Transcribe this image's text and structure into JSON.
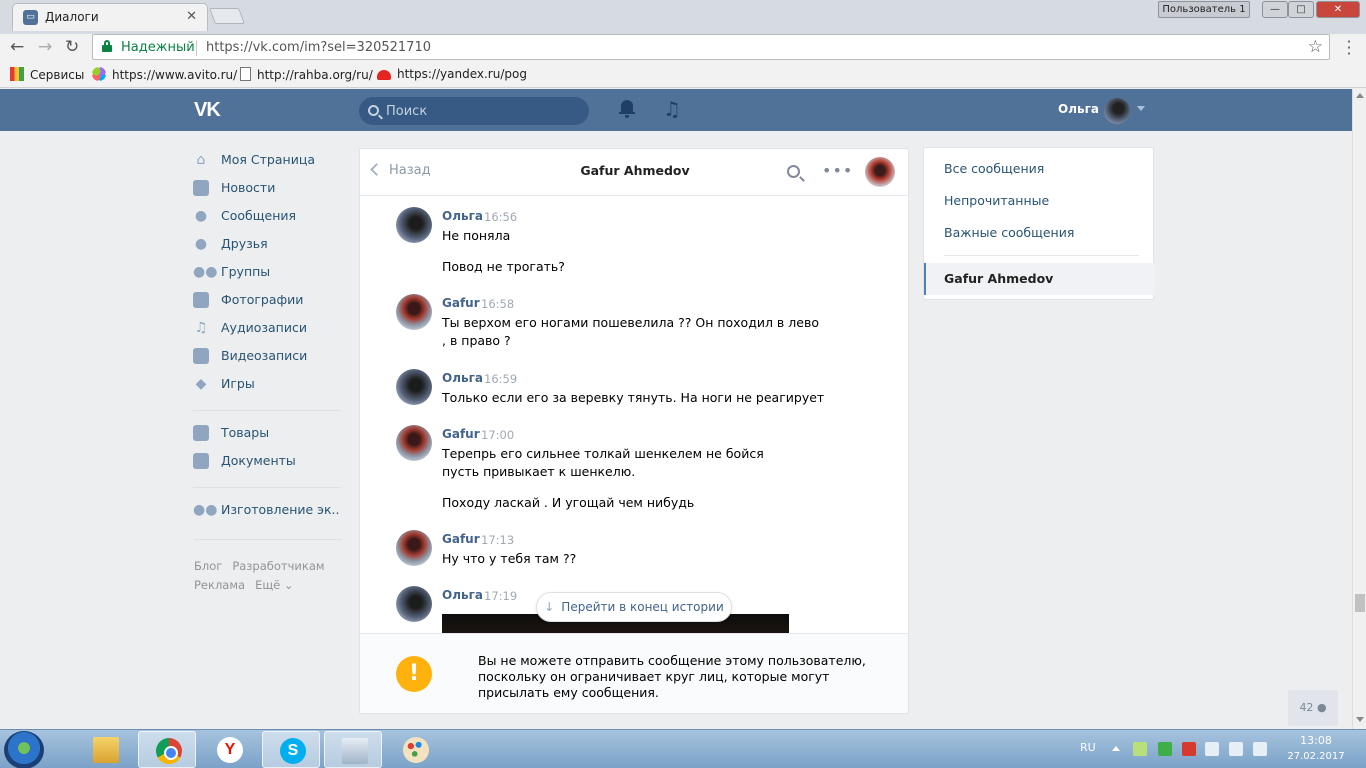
{
  "browser": {
    "tab_title": "Диалоги",
    "tab_close": "✕",
    "user_button": "Пользователь 1",
    "window_min": "—",
    "window_max": "□",
    "window_close": "✕",
    "secure_label": "Надежный",
    "url": "https://vk.com/im?sel=320521710",
    "bookmarks": [
      {
        "label": "Сервисы"
      },
      {
        "label": "https://www.avito.ru/"
      },
      {
        "label": "http://rahba.org/ru/"
      },
      {
        "label": "https://yandex.ru/pog"
      }
    ]
  },
  "header": {
    "logo": "VK",
    "search_placeholder": "Поиск",
    "user_name": "Ольга"
  },
  "left_menu": {
    "items": [
      {
        "label": "Моя Страница",
        "icon": "home-icon"
      },
      {
        "label": "Новости",
        "icon": "news-icon"
      },
      {
        "label": "Сообщения",
        "icon": "messages-icon"
      },
      {
        "label": "Друзья",
        "icon": "friends-icon"
      },
      {
        "label": "Группы",
        "icon": "groups-icon"
      },
      {
        "label": "Фотографии",
        "icon": "camera-icon"
      },
      {
        "label": "Аудиозаписи",
        "icon": "music-icon"
      },
      {
        "label": "Видеозаписи",
        "icon": "video-icon"
      },
      {
        "label": "Игры",
        "icon": "gamepad-icon"
      },
      {
        "label": "Товары",
        "icon": "bag-icon"
      },
      {
        "label": "Документы",
        "icon": "document-icon"
      },
      {
        "label": "Изготовление эк..",
        "icon": "group-icon"
      }
    ],
    "footer": [
      "Блог",
      "Разработчикам",
      "Реклама",
      "Ещё ⌄"
    ]
  },
  "dialog": {
    "back_label": "Назад",
    "title": "Gafur Ahmedov",
    "messages": [
      {
        "author": "Ольга",
        "time": "16:56",
        "lines": [
          "Не поняла",
          "Повод не трогать?"
        ]
      },
      {
        "author": "Gafur",
        "time": "16:58",
        "lines": [
          "Ты верхом его ногами пошевелила ?? Он походил в лево , в право ?"
        ]
      },
      {
        "author": "Ольга",
        "time": "16:59",
        "lines": [
          "Только если его за веревку тянуть. На ноги не реагирует"
        ]
      },
      {
        "author": "Gafur",
        "time": "17:00",
        "lines": [
          "Терепрь его сильнее толкай шенкелем не бойся пусть привыкает к шенкелю.",
          "Походу ласкай . И угощай чем нибудь"
        ]
      },
      {
        "author": "Gafur",
        "time": "17:13",
        "lines": [
          "Ну что у тебя там ??"
        ]
      },
      {
        "author": "Ольга",
        "time": "17:19",
        "lines": []
      }
    ],
    "jump_label": "Перейти в конец истории",
    "warning_icon": "!",
    "warning_text": "Вы не можете отправить сообщение этому пользователю, поскольку он ограничивает круг лиц, которые могут присылать ему сообщения."
  },
  "right_menu": {
    "items": [
      "Все сообщения",
      "Непрочитанные",
      "Важные сообщения"
    ],
    "active": "Gafur Ahmedov"
  },
  "online_count": "42",
  "taskbar": {
    "lang": "RU",
    "time": "13:08",
    "date": "27.02.2017"
  }
}
